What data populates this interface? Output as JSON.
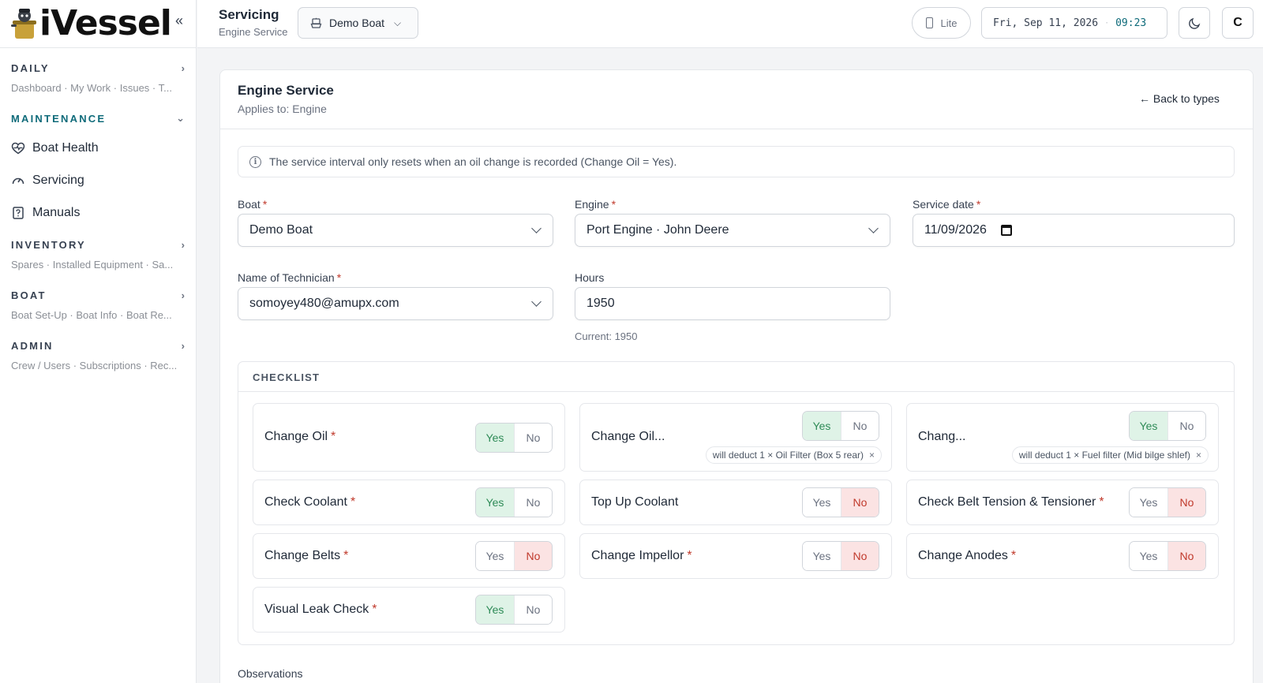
{
  "app": {
    "name": "iVessel"
  },
  "sidebar": {
    "sections": [
      {
        "title": "DAILY",
        "sub": "Dashboard · My Work · Issues · T..."
      },
      {
        "title": "MAINTENANCE"
      },
      {
        "title": "INVENTORY",
        "sub": "Spares · Installed Equipment · Sa..."
      },
      {
        "title": "BOAT",
        "sub": "Boat Set-Up · Boat Info · Boat Re..."
      },
      {
        "title": "ADMIN",
        "sub": "Crew / Users · Subscriptions · Rec..."
      }
    ],
    "items": [
      {
        "label": "Boat Health",
        "icon": "heart-pulse-icon"
      },
      {
        "label": "Servicing",
        "icon": "gauge-icon"
      },
      {
        "label": "Manuals",
        "icon": "document-icon"
      }
    ]
  },
  "header": {
    "title": "Servicing",
    "subtitle": "Engine Service",
    "boat": "Demo Boat",
    "lite": "Lite",
    "date": "Fri, Sep 11, 2026",
    "time": "09:23",
    "avatar": "C",
    "accent": "#0f6b7a"
  },
  "card": {
    "title": "Engine Service",
    "subtitle": "Applies to: Engine",
    "back": "← Back to types",
    "info": "The service interval only resets when an oil change is recorded (Change Oil = Yes)."
  },
  "form": {
    "boat": {
      "label": "Boat",
      "value": "Demo Boat"
    },
    "engine": {
      "label": "Engine",
      "value": "Port Engine · John Deere"
    },
    "service_date": {
      "label": "Service date",
      "value": "11/09/2026"
    },
    "technician": {
      "label": "Name of Technician",
      "value": "somoyey480@amupx.com"
    },
    "hours": {
      "label": "Hours",
      "value": "1950",
      "current": "Current: 1950"
    }
  },
  "checklist": {
    "title": "CHECKLIST",
    "yes": "Yes",
    "no": "No",
    "items": [
      {
        "label": "Change Oil",
        "required": "*",
        "value": "yes"
      },
      {
        "label": "Change Oil...",
        "value": "yes",
        "deduct": "will deduct 1 × Oil Filter (Box 5 rear)"
      },
      {
        "label": "Chang...",
        "value": "yes",
        "deduct": "will deduct 1 × Fuel filter (Mid bilge shlef)"
      },
      {
        "label": "Check Coolant",
        "required": "*",
        "value": "yes"
      },
      {
        "label": "Top Up Coolant",
        "value": "no"
      },
      {
        "label": "Check Belt Tension & Tensioner",
        "required": "*",
        "value": "no"
      },
      {
        "label": "Change Belts",
        "required": "*",
        "value": "no"
      },
      {
        "label": "Change Impellor",
        "required": "*",
        "value": "no"
      },
      {
        "label": "Change Anodes",
        "required": "*",
        "value": "no"
      },
      {
        "label": "Visual Leak Check",
        "required": "*",
        "value": "yes"
      }
    ]
  },
  "observations": {
    "label": "Observations"
  }
}
